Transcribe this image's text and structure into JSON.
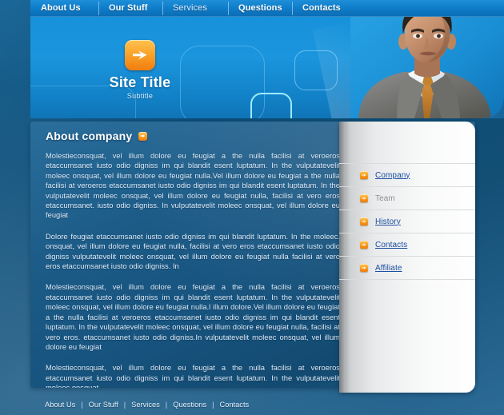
{
  "site": {
    "title": "Site Title",
    "subtitle": "Subtitle",
    "logo_icon": "arrow-right-icon",
    "brand_orange": "#f79f22",
    "brand_blue": "#1792da"
  },
  "topnav": {
    "items": [
      {
        "label": "About Us",
        "active": true
      },
      {
        "label": "Our Stuff",
        "active": true
      },
      {
        "label": "Services",
        "active": false
      },
      {
        "label": "Questions",
        "active": true
      },
      {
        "label": "Contacts",
        "active": true
      }
    ]
  },
  "banner": {
    "photo_alt": "businessman-portrait"
  },
  "main": {
    "section_title": "About company",
    "section_badge_icon": "arrow-right-badge-icon",
    "paragraphs": [
      "Molestieconsquat, vel illum dolore eu feugiat a the nulla facilisi at veroeros etaccumsanet iusto odio digniss im qui blandit esent luptatum. In the vulputatevelit moleec onsquat, vel illum dolore eu feugiat nulla.Vel illum dolore eu feugiat a the nulla facilisi at veroeros etaccumsanet iusto odio digniss im qui blandit esent luptatum. In the vulputatevelit moleec onsquat, vel illum dolore eu feugiat nulla, facilisi at vero eros etaccumsanet. iusto odio digniss. In vulputatevelit moleec onsquat, vel illum dolore eu feugiat",
      "Dolore feugiat   etaccumsanet iusto odio digniss im qui blandit luptatum. In the moleec. onsquat, vel illum dolore eu feugiat nulla, facilisi at vero eros etaccumsanet iusto odio digniss vulputatevelit moleec onsquat, vel illum dolore eu feugiat nulla facilisi at vero eros etaccumsanet iusto odio digniss. In",
      "Molestieconsquat, vel illum dolore eu feugiat a the nulla facilisi at veroeros etaccumsanet iusto odio digniss im qui blandit esent luptatum. In the vulputatevelit moleec onsquat, vel illum dolore eu feugiat nulla.l illum dolore.Vel illum dolore eu feugiat a the nulla facilisi at veroeros etaccumsanet iusto odio digniss im qui blandit esent luptatum. In the vulputatevelit moleec onsquat, vel illum dolore eu feugiat nulla, facilisi at vero eros. etaccumsanet iusto odio digniss.In vulputatevelit moleec onsquat, vel illum dolore eu feugiat",
      "Molestieconsquat, vel illum dolore eu feugiat a the nulla facilisi at veroeros etaccumsanet iusto odio digniss im qui blandit esent luptatum. In the vulputatevelit moleec onsquat."
    ]
  },
  "sidebar": {
    "items": [
      {
        "label": "Company",
        "enabled": true
      },
      {
        "label": "Team",
        "enabled": false
      },
      {
        "label": "History",
        "enabled": true
      },
      {
        "label": "Contacts",
        "enabled": true
      },
      {
        "label": "Affiliate",
        "enabled": true
      }
    ]
  },
  "footer": {
    "separator": "|",
    "links": [
      {
        "label": "About Us"
      },
      {
        "label": "Our Stuff"
      },
      {
        "label": "Services"
      },
      {
        "label": "Questions"
      },
      {
        "label": "Contacts"
      }
    ]
  }
}
